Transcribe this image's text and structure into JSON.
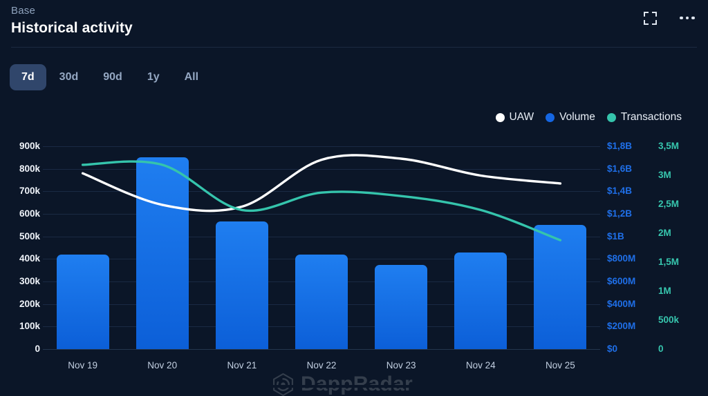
{
  "header": {
    "subtitle": "Base",
    "title": "Historical activity",
    "expand_icon": "expand-icon",
    "menu_icon": "more-options-icon"
  },
  "range_tabs": [
    {
      "label": "7d",
      "active": true
    },
    {
      "label": "30d",
      "active": false
    },
    {
      "label": "90d",
      "active": false
    },
    {
      "label": "1y",
      "active": false
    },
    {
      "label": "All",
      "active": false
    }
  ],
  "legend": [
    {
      "label": "UAW",
      "color": "#ffffff"
    },
    {
      "label": "Volume",
      "color": "#1566e3"
    },
    {
      "label": "Transactions",
      "color": "#35c4ac"
    }
  ],
  "watermark": {
    "text": "DappRadar",
    "logo_icon": "dappradar-logo-icon"
  },
  "colors": {
    "background": "#0b1628",
    "bar_blue": "#1370e8",
    "uaw_white": "#ffffff",
    "transactions_teal": "#35c4ac",
    "volume_axis": "#1f6fe8",
    "gridline": "#1a2a44",
    "tab_active_bg": "#30466b"
  },
  "chart_data": {
    "type": "bar",
    "title": "Historical activity",
    "subtitle": "Base",
    "xlabel": "",
    "grid": true,
    "legend_position": "top-right",
    "categories": [
      "Nov 19",
      "Nov 20",
      "Nov 21",
      "Nov 22",
      "Nov 23",
      "Nov 24",
      "Nov 25"
    ],
    "axes": {
      "left": {
        "name": "UAW",
        "color": "#ffffff",
        "ylim": [
          0,
          900000
        ],
        "ticks": [
          0,
          100000,
          200000,
          300000,
          400000,
          500000,
          600000,
          700000,
          800000,
          900000
        ],
        "ticklabels": [
          "0",
          "100k",
          "200k",
          "300k",
          "400k",
          "500k",
          "600k",
          "700k",
          "800k",
          "900k"
        ]
      },
      "right_volume": {
        "name": "Volume",
        "color": "#1f6fe8",
        "ylim": [
          0,
          1800000000
        ],
        "ticks": [
          0,
          200000000,
          400000000,
          600000000,
          800000000,
          1000000000,
          1200000000,
          1400000000,
          1600000000,
          1800000000
        ],
        "ticklabels": [
          "$0",
          "$200M",
          "$400M",
          "$600M",
          "$800M",
          "$1B",
          "$1,2B",
          "$1,4B",
          "$1,6B",
          "$1,8B"
        ]
      },
      "right_transactions": {
        "name": "Transactions",
        "color": "#35c4ac",
        "ylim": [
          0,
          3500000
        ],
        "ticks": [
          0,
          500000,
          1000000,
          1500000,
          2000000,
          2500000,
          3000000,
          3500000
        ],
        "ticklabels": [
          "0",
          "500k",
          "1M",
          "1,5M",
          "2M",
          "2,5M",
          "3M",
          "3,5M"
        ]
      }
    },
    "series": [
      {
        "name": "Volume",
        "type": "bar",
        "axis": "right_volume",
        "color": "#1370e8",
        "values": [
          840000000,
          1700000000,
          1130000000,
          840000000,
          745000000,
          855000000,
          1105000000
        ],
        "value_labels": [
          "$840M",
          "$1,70B",
          "$1,13B",
          "$840M",
          "$745M",
          "$855M",
          "$1,11B"
        ]
      },
      {
        "name": "UAW",
        "type": "line",
        "axis": "left",
        "color": "#ffffff",
        "values": [
          780000,
          640000,
          632000,
          840000,
          845000,
          770000,
          735000
        ]
      },
      {
        "name": "Transactions",
        "type": "line",
        "axis": "right_transactions",
        "color": "#35c4ac",
        "values": [
          3180000,
          3180000,
          2400000,
          2700000,
          2640000,
          2400000,
          1880000
        ]
      }
    ]
  }
}
